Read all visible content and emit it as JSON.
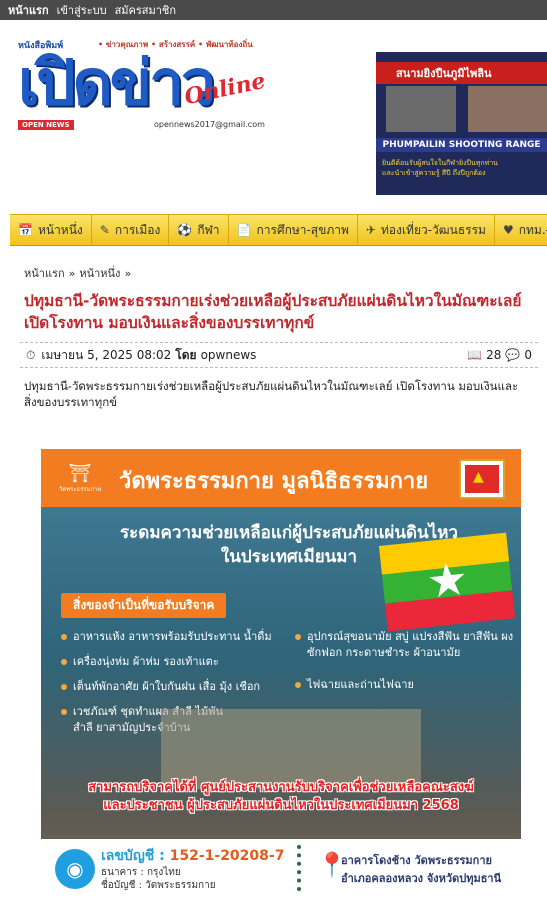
{
  "topbar": {
    "links": [
      "หน้าแรก",
      "เข้าสู่ระบบ",
      "สมัครสมาชิก"
    ]
  },
  "logo": {
    "taglines": "หนังสือพิมพ์",
    "slogan": "• ข่าวคุณภาพ • สร้างสรรค์ • พัฒนาท้องถิ่น",
    "name": "เปิดข่าว",
    "online": "Online",
    "badge": "OPEN NEWS",
    "email": "opennews2017@gmail.com"
  },
  "header_ad": {
    "title": "สนามยิงปืนภูมิไพลิน",
    "banner": "PHUMPAILIN SHOOTING RANGE",
    "text1": "ยินดีต้อนรับผู้สนใจในกีฬายิงปืนทุกท่าน",
    "text2": "และนำเข้าสู่ความรู้ สีปี ถึงปีถูกต้อง"
  },
  "nav": {
    "items": [
      {
        "icon": "📅",
        "label": "หน้าหนึ่ง"
      },
      {
        "icon": "✎",
        "label": "การเมือง"
      },
      {
        "icon": "⚽",
        "label": "กีฬา"
      },
      {
        "icon": "📄",
        "label": "การศึกษา-สุขภาพ"
      },
      {
        "icon": "✈",
        "label": "ท่องเที่ยว-วัฒนธรรม"
      },
      {
        "icon": "♥",
        "label": "กทม.-ภูมิภาค"
      }
    ]
  },
  "breadcrumb": {
    "home": "หน้าแรก",
    "sep": "»",
    "section": "หน้าหนึ่ง",
    "sep2": "»"
  },
  "article": {
    "title": "ปทุมธานี-วัดพระธรรมกายเร่งช่วยเหลือผู้ประสบภัยแผ่นดินไหวในมัณฑะเลย์ เปิดโรงทาน มอบเงินและสิ่งของบรรเทาทุกข์",
    "date": "เมษายน 5, 2025 08:02",
    "by": "โดย",
    "author": "opwnews",
    "views": "28",
    "comments": "0",
    "excerpt": "ปทุมธานี-วัดพระธรรมกายเร่งช่วยเหลือผู้ประสบภัยแผ่นดินไหวในมัณฑะเลย์ เปิดโรงทาน มอบเงินและสิ่งของบรรเทาทุกข์"
  },
  "poster": {
    "org": "วัดพระธรรมกาย มูลนิธิธรรมกาย",
    "logo_caption": "วัดพระธรรมกาย",
    "headline1": "ระดมความช่วยเหลือแก่ผู้ประสบภัยแผ่นดินไหว",
    "headline2": "ในประเทศเมียนมา",
    "needs_label": "สิ่งของจำเป็นที่ขอรับบริจาค",
    "items_left": [
      "อาหารแห้ง อาหารพร้อมรับประทาน น้ำดื่ม",
      "เครื่องนุ่งห่ม ผ้าห่ม รองเท้าแตะ",
      "เต็นท์พักอาศัย ผ้าใบกันฝน เสื่อ มุ้ง เชือก",
      "เวชภัณฑ์ ชุดทำแผล สำลี ไม้พันสำลี ยาสามัญประจำบ้าน"
    ],
    "items_right": [
      "อุปกรณ์สุขอนามัย สบู่ แปรงสีฟัน ยาสีฟัน ผงซักฟอก กระดาษชำระ ผ้าอนามัย",
      "ไฟฉายและถ่านไฟฉาย"
    ],
    "donate1": "สามารถบริจาคได้ที่ ศูนย์ประสานงานรับบริจาคเพื่อช่วยเหลือคณะสงฆ์",
    "donate2": "และประชาชน ผู้ประสบภัยแผ่นดินไหวในประเทศเมียนมา 2568",
    "account_label": "เลขบัญชี :",
    "account_no": "152-1-20208-7",
    "bank": "ธนาคาร : กรุงไทย",
    "account_name": "ชื่อบัญชี : วัดพระธรรมกาย",
    "address1": "อาคารโดงช้าง วัดพระธรรมกาย",
    "address2": "อำเภอคลองหลวง จังหวัดปทุมธานี"
  }
}
